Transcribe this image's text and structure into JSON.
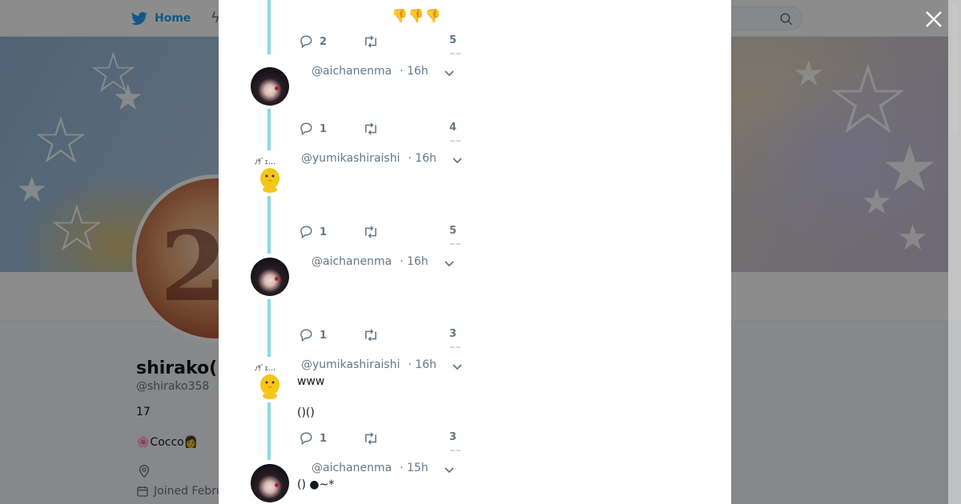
{
  "nav": {
    "home_label": "Home"
  },
  "profile": {
    "name": "shirako([",
    "handle": "@shirako358",
    "bio_line1": "17",
    "bio_line2": "🌸Cocco👩",
    "joined": "Joined Febru",
    "avatar_text": "2"
  },
  "colors": {
    "accent": "#1da1f2",
    "thread_line": "#8fd7e0",
    "muted": "#657786",
    "text": "#14171a"
  },
  "thread": {
    "top_emoji": "👎👎👎",
    "tweets": [
      {
        "handle": "@aichanenma",
        "time": "· 16h",
        "text": "",
        "avatar": "goth-girl-avatar",
        "replies": "",
        "retweets": "",
        "likes": ""
      },
      {
        "handle": "@yumikashiraishi",
        "time": "· 16h",
        "text": "",
        "avatar": "yellow-chick-avatar",
        "replies": "",
        "retweets": "",
        "likes": ""
      },
      {
        "handle": "@aichanenma",
        "time": "· 16h",
        "text": "",
        "avatar": "goth-girl-avatar",
        "replies": "",
        "retweets": "",
        "likes": ""
      },
      {
        "handle": "@yumikashiraishi",
        "time": "· 16h",
        "text": "www",
        "text2": "()()",
        "avatar": "yellow-chick-avatar",
        "replies": "",
        "retweets": "",
        "likes": ""
      },
      {
        "handle": "@aichanenma",
        "time": "· 15h",
        "text": "() ●~*",
        "avatar": "goth-girl-avatar"
      }
    ],
    "action_rows": [
      {
        "replies": "2",
        "likes": "5"
      },
      {
        "replies": "1",
        "likes": "4"
      },
      {
        "replies": "1",
        "likes": "5"
      },
      {
        "replies": "1",
        "likes": "3"
      },
      {
        "replies": "1",
        "likes": "3"
      }
    ],
    "like_mark": "~~"
  },
  "icons": [
    "twitter-bird-icon",
    "bolt-icon",
    "search-icon",
    "close-icon",
    "reply-icon",
    "retweet-icon",
    "chevron-down-icon",
    "location-icon",
    "calendar-icon"
  ]
}
